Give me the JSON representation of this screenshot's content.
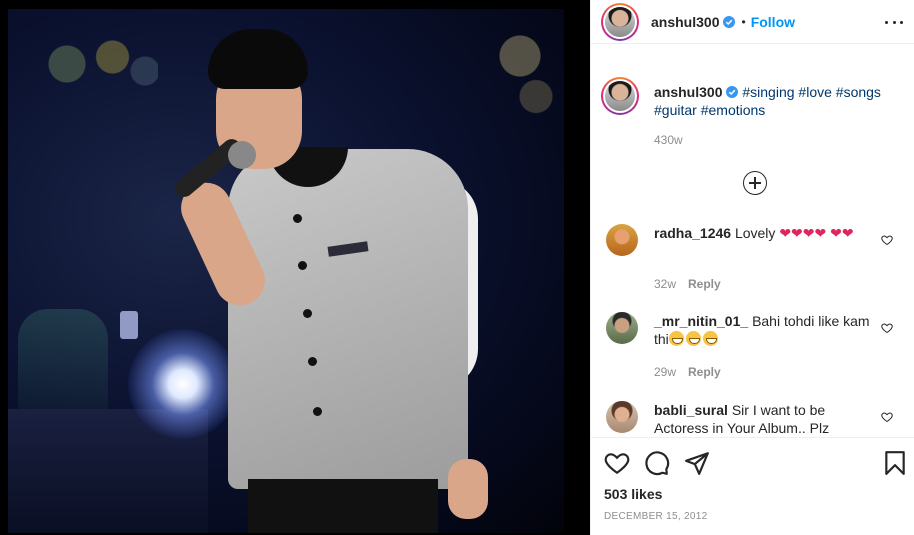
{
  "post": {
    "author": "anshul300",
    "follow_label": "Follow",
    "separator": "•",
    "caption": {
      "user": "anshul300",
      "hashtags": [
        "#singing",
        "#love",
        "#songs",
        "#guitar",
        "#emotions"
      ],
      "age": "430w"
    },
    "likes": "503 likes",
    "date": "DECEMBER 15, 2012"
  },
  "comments": [
    {
      "user": "radha_1246",
      "text": "Lovely",
      "emoji": [
        "❤",
        "❤",
        "❤",
        "❤",
        "❤",
        "❤"
      ],
      "age": "32w",
      "reply": "Reply"
    },
    {
      "user": "_mr_nitin_01_",
      "text": "Bahi tohdi like kam thi",
      "emoji_count": 3,
      "age": "29w",
      "reply": "Reply"
    },
    {
      "user": "babli_sural",
      "text": "Sir I want to be Actoress in Your Album.. Plz"
    }
  ],
  "icons": {
    "verified": "verified-badge-icon",
    "more": "more-options-icon",
    "load_more": "plus-circle-icon",
    "like": "heart-icon",
    "comment": "comment-icon",
    "share": "paper-plane-icon",
    "save": "bookmark-icon"
  },
  "colors": {
    "link": "#0095f6",
    "hashtag": "#00376b",
    "muted": "#8e8e8e",
    "heart": "#e0245e"
  }
}
